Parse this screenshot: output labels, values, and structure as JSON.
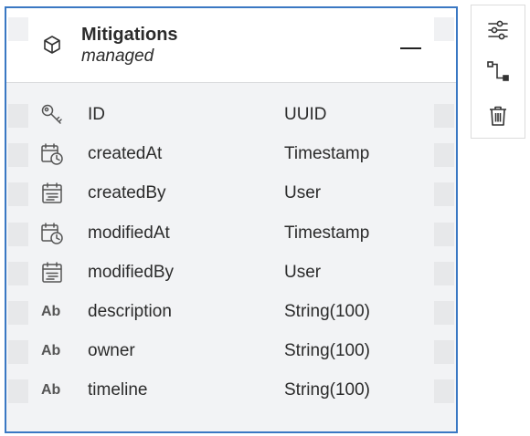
{
  "entity": {
    "title": "Mitigations",
    "subtitle": "managed",
    "icon": "cube-icon",
    "collapse_icon": "minus-icon"
  },
  "fields": [
    {
      "name": "ID",
      "type": "UUID",
      "icon": "key-icon"
    },
    {
      "name": "createdAt",
      "type": "Timestamp",
      "icon": "calendar-clock-icon"
    },
    {
      "name": "createdBy",
      "type": "User",
      "icon": "calendar-user-icon"
    },
    {
      "name": "modifiedAt",
      "type": "Timestamp",
      "icon": "calendar-clock-icon"
    },
    {
      "name": "modifiedBy",
      "type": "User",
      "icon": "calendar-user-icon"
    },
    {
      "name": "description",
      "type": "String(100)",
      "icon": "text",
      "icon_text": "Ab"
    },
    {
      "name": "owner",
      "type": "String(100)",
      "icon": "text",
      "icon_text": "Ab"
    },
    {
      "name": "timeline",
      "type": "String(100)",
      "icon": "text",
      "icon_text": "Ab"
    }
  ],
  "toolbar": {
    "items": [
      "settings-sliders-icon",
      "connector-icon",
      "trash-icon"
    ]
  },
  "colors": {
    "selection_border": "#3a78c3",
    "card_background": "#f2f3f5",
    "header_background": "#ffffff"
  }
}
